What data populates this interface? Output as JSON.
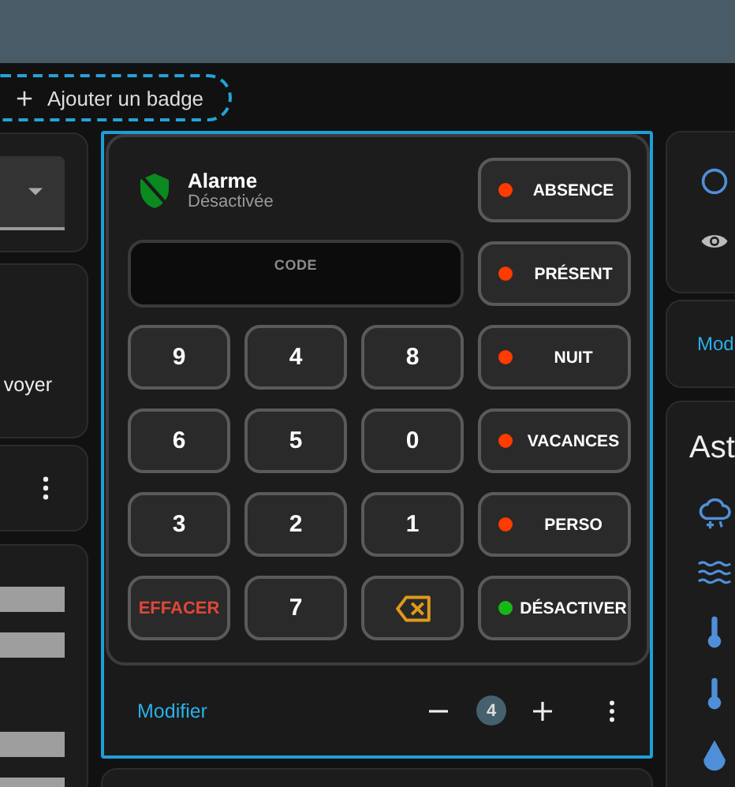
{
  "badge_button": {
    "label": "Ajouter un badge"
  },
  "left_column": {
    "card_text": "voyer"
  },
  "alarm_card": {
    "name": "Alarme",
    "state": "Désactivée",
    "code_field": {
      "placeholder": "CODE"
    },
    "keys": [
      {
        "kind": "digit",
        "label": "9"
      },
      {
        "kind": "digit",
        "label": "4"
      },
      {
        "kind": "digit",
        "label": "8"
      },
      {
        "kind": "digit",
        "label": "6"
      },
      {
        "kind": "digit",
        "label": "5"
      },
      {
        "kind": "digit",
        "label": "0"
      },
      {
        "kind": "digit",
        "label": "3"
      },
      {
        "kind": "digit",
        "label": "2"
      },
      {
        "kind": "digit",
        "label": "1"
      },
      {
        "kind": "clear",
        "label": "EFFACER"
      },
      {
        "kind": "digit",
        "label": "7"
      },
      {
        "kind": "backspace"
      }
    ],
    "modes": [
      {
        "label": "ABSENCE",
        "color": "#ff3b00"
      },
      {
        "label": "PRÉSENT",
        "color": "#ff3b00"
      },
      {
        "label": "NUIT",
        "color": "#ff3b00"
      },
      {
        "label": "VACANCES",
        "color": "#ff3b00"
      },
      {
        "label": "PERSO",
        "color": "#ff3b00"
      },
      {
        "label": "DÉSACTIVER",
        "color": "#16b816"
      }
    ]
  },
  "edit_bar": {
    "edit_label": "Modifier",
    "size": "4"
  },
  "right_column": {
    "link_text": "Mod",
    "card_title": "Ast"
  }
}
